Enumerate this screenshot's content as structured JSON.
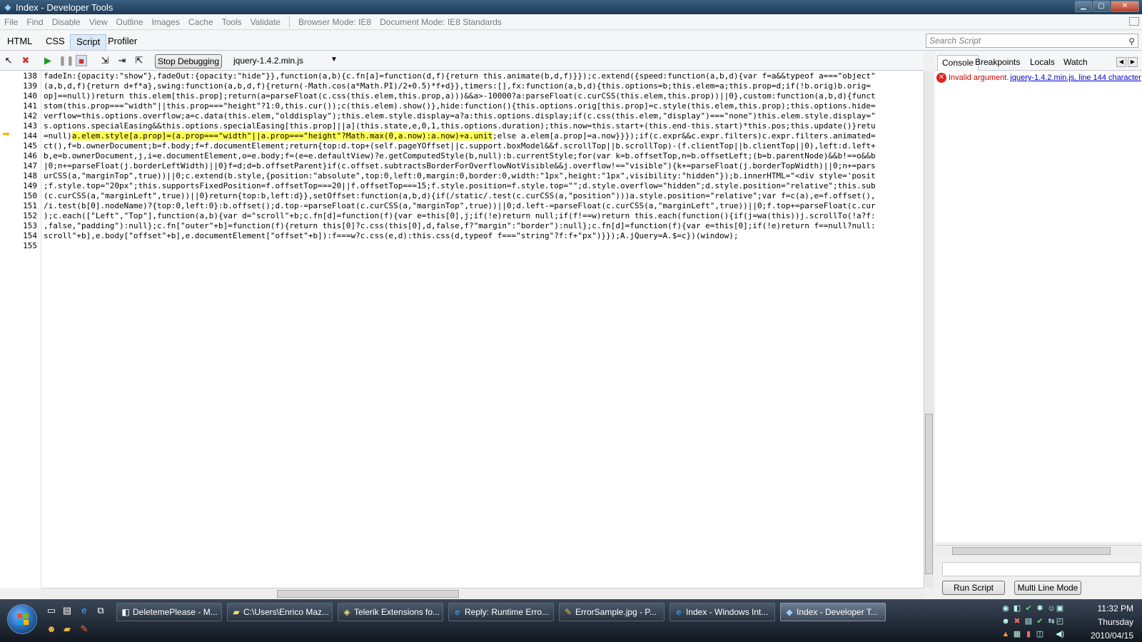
{
  "window": {
    "title": "Index - Developer Tools",
    "app_icon": "ie-devtools-icon",
    "controls": [
      "minimize",
      "maximize",
      "close"
    ]
  },
  "menubar": {
    "items": [
      "File",
      "Find",
      "Disable",
      "View",
      "Outline",
      "Images",
      "Cache",
      "Tools",
      "Validate"
    ],
    "browser_mode": "Browser Mode: IE8",
    "document_mode": "Document Mode: IE8 Standards"
  },
  "tabs": [
    "HTML",
    "CSS",
    "Script",
    "Profiler"
  ],
  "active_tab": "Script",
  "search": {
    "placeholder": "Search Script"
  },
  "toolbar": {
    "stop_debugging": "Stop Debugging",
    "file": "jquery-1.4.2.min.js"
  },
  "code": {
    "current_line": "144",
    "lines": [
      {
        "n": "138",
        "pre": "fadeIn:{opacity:\"show\"},fadeOut:{opacity:\"hide\"}},function(a,b){c.fn[a]=function(d,f){return this.animate(b,d,f)}});c.extend({speed:function(a,b,d){var f=a&&typeof a===\"object\"",
        "hl": "",
        "post": ""
      },
      {
        "n": "139",
        "pre": "(a,b,d,f){return d+f*a},swing:function(a,b,d,f){return(-Math.cos(a*Math.PI)/2+0.5)*f+d}},timers:[],fx:function(a,b,d){this.options=b;this.elem=a;this.prop=d;if(!b.orig)b.orig=",
        "hl": "",
        "post": ""
      },
      {
        "n": "140",
        "pre": "op]==null))return this.elem[this.prop];return(a=parseFloat(c.css(this.elem,this.prop,a)))&&a>-10000?a:parseFloat(c.curCSS(this.elem,this.prop))||0},custom:function(a,b,d){funct",
        "hl": "",
        "post": ""
      },
      {
        "n": "141",
        "pre": "stom(this.prop===\"width\"||this.prop===\"height\"?1:0,this.cur());c(this.elem).show()},hide:function(){this.options.orig[this.prop]=c.style(this.elem,this.prop);this.options.hide=",
        "hl": "",
        "post": ""
      },
      {
        "n": "142",
        "pre": "verflow=this.options.overflow;a=c.data(this.elem,\"olddisplay\");this.elem.style.display=a?a:this.options.display;if(c.css(this.elem,\"display\")===\"none\")this.elem.style.display=\"",
        "hl": "",
        "post": ""
      },
      {
        "n": "143",
        "pre": "s.options.specialEasing&&this.options.specialEasing[this.prop]||a](this.state,e,0,1,this.options.duration);this.now=this.start+(this.end-this.start)*this.pos;this.update()}retu",
        "hl": "",
        "post": ""
      },
      {
        "n": "144",
        "pre": "=null)",
        "hl": "a.elem.style[a.prop]=(a.prop===\"width\"||a.prop===\"height\"?Math.max(0,a.now):a.now)+a.unit",
        "post": ";else a.elem[a.prop]=a.now}}});if(c.expr&&c.expr.filters)c.expr.filters.animated="
      },
      {
        "n": "145",
        "pre": "ct(),f=b.ownerDocument;b=f.body;f=f.documentElement;return{top:d.top+(self.pageYOffset||c.support.boxModel&&f.scrollTop||b.scrollTop)-(f.clientTop||b.clientTop||0),left:d.left+",
        "hl": "",
        "post": ""
      },
      {
        "n": "146",
        "pre": "b,e=b.ownerDocument,j,i=e.documentElement,o=e.body;f=(e=e.defaultView)?e.getComputedStyle(b,null):b.currentStyle;for(var k=b.offsetTop,n=b.offsetLeft;(b=b.parentNode)&&b!==o&&b",
        "hl": "",
        "post": ""
      },
      {
        "n": "147",
        "pre": "|0;n+=parseFloat(j.borderLeftWidth)||0}f=d;d=b.offsetParent}if(c.offset.subtractsBorderForOverflowNotVisible&&j.overflow!==\"visible\"){k+=parseFloat(j.borderTopWidth)||0;n+=pars",
        "hl": "",
        "post": ""
      },
      {
        "n": "148",
        "pre": "urCSS(a,\"marginTop\",true))||0;c.extend(b.style,{position:\"absolute\",top:0,left:0,margin:0,border:0,width:\"1px\",height:\"1px\",visibility:\"hidden\"});b.innerHTML=\"<div style='posit",
        "hl": "",
        "post": ""
      },
      {
        "n": "149",
        "pre": ";f.style.top=\"20px\";this.supportsFixedPosition=f.offsetTop===20||f.offsetTop===15;f.style.position=f.style.top=\"\";d.style.overflow=\"hidden\";d.style.position=\"relative\";this.sub",
        "hl": "",
        "post": ""
      },
      {
        "n": "150",
        "pre": "(c.curCSS(a,\"marginLeft\",true))||0}return{top:b,left:d}},setOffset:function(a,b,d){if(/static/.test(c.curCSS(a,\"position\")))a.style.position=\"relative\";var f=c(a),e=f.offset(),",
        "hl": "",
        "post": ""
      },
      {
        "n": "151",
        "pre": "/i.test(b[0].nodeName)?{top:0,left:0}:b.offset();d.top-=parseFloat(c.curCSS(a,\"marginTop\",true))||0;d.left-=parseFloat(c.curCSS(a,\"marginLeft\",true))||0;f.top+=parseFloat(c.cur",
        "hl": "",
        "post": ""
      },
      {
        "n": "152",
        "pre": ");c.each([\"Left\",\"Top\"],function(a,b){var d=\"scroll\"+b;c.fn[d]=function(f){var e=this[0],j;if(!e)return null;if(f!==w)return this.each(function(){if(j=wa(this))j.scrollTo(!a?f:",
        "hl": "",
        "post": ""
      },
      {
        "n": "153",
        "pre": ",false,\"padding\"):null};c.fn[\"outer\"+b]=function(f){return this[0]?c.css(this[0],d,false,f?\"margin\":\"border\"):null};c.fn[d]=function(f){var e=this[0];if(!e)return f==null?null:",
        "hl": "",
        "post": ""
      },
      {
        "n": "154",
        "pre": "scroll\"+b],e.body[\"offset\"+b],e.documentElement[\"offset\"+b]):f===w?c.css(e,d):this.css(d,typeof f===\"string\"?f:f+\"px\")}});A.jQuery=A.$=c})(window);",
        "hl": "",
        "post": ""
      },
      {
        "n": "155",
        "pre": "",
        "hl": "",
        "post": ""
      }
    ]
  },
  "right_panel": {
    "tabs": [
      "Console",
      "Breakpoints",
      "Locals",
      "Watch"
    ],
    "active_tab": "Console",
    "error": {
      "message": "Invalid argument.",
      "location": "jquery-1.4.2.min.js, line 144 character"
    },
    "run_script": "Run Script",
    "multi_line_mode": "Multi Line Mode"
  },
  "taskbar": {
    "tasks": [
      {
        "label": "DeletemePlease - M...",
        "icon": "vs-icon"
      },
      {
        "label": "C:\\Users\\Enrico Maz...",
        "icon": "folder-icon"
      },
      {
        "label": "Telerik Extensions fo...",
        "icon": "browser-icon"
      },
      {
        "label": "Reply: Runtime Erro...",
        "icon": "ie-icon"
      },
      {
        "label": "ErrorSample.jpg - P...",
        "icon": "paint-icon"
      },
      {
        "label": "Index - Windows Int...",
        "icon": "ie-icon"
      },
      {
        "label": "Index - Developer T...",
        "icon": "devtools-icon"
      }
    ],
    "clock": {
      "time": "11:32 PM",
      "day": "Thursday",
      "date": "2010/04/15"
    }
  }
}
